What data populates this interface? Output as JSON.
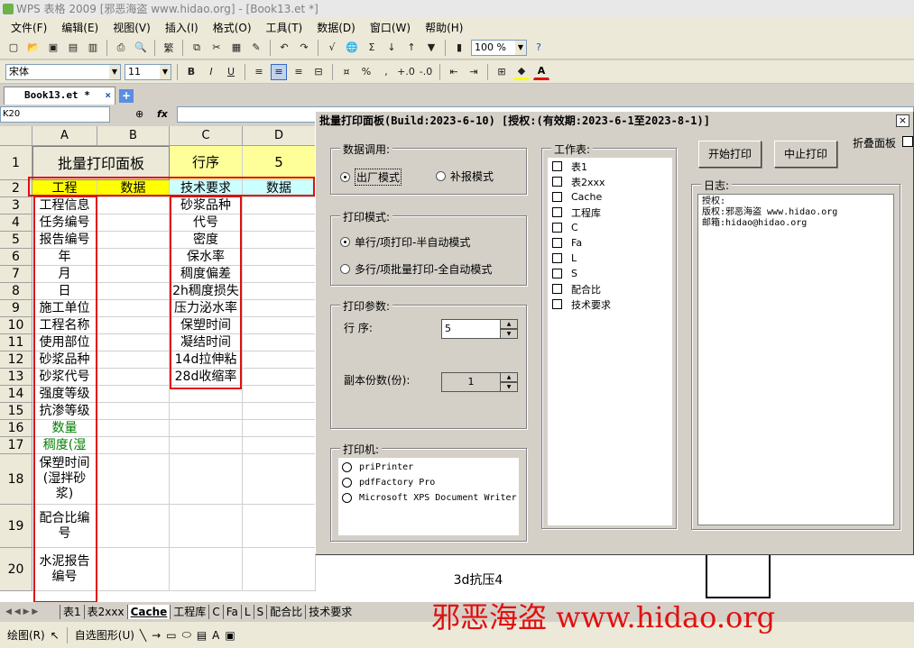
{
  "window": {
    "title": "WPS 表格 2009 [邪恶海盗 www.hidao.org] - [Book13.et *]"
  },
  "menu": [
    "文件(F)",
    "编辑(E)",
    "视图(V)",
    "插入(I)",
    "格式(O)",
    "工具(T)",
    "数据(D)",
    "窗口(W)",
    "帮助(H)"
  ],
  "toolbar": {
    "zoom": "100 %",
    "font": "宋体",
    "size": "11",
    "bold": "B",
    "italic": "I",
    "underline": "U",
    "percent": "%",
    "sigma": "Σ"
  },
  "doc_tab": {
    "name": "Book13.et *",
    "close": "×",
    "add": "+"
  },
  "formula": {
    "namebox": "K20",
    "fx": "fx"
  },
  "sheet": {
    "columns": [
      "A",
      "B",
      "C",
      "D"
    ],
    "rows": [
      {
        "n": "1",
        "a": "批量打印面板",
        "b": "",
        "c": "行序",
        "d": "5"
      },
      {
        "n": "2",
        "a": "工程",
        "b": "数据",
        "c": "技术要求",
        "d": "数据"
      },
      {
        "n": "3",
        "a": "工程信息",
        "c": "砂浆品种"
      },
      {
        "n": "4",
        "a": "任务编号",
        "c": "代号"
      },
      {
        "n": "5",
        "a": "报告编号",
        "c": "密度"
      },
      {
        "n": "6",
        "a": "年",
        "c": "保水率"
      },
      {
        "n": "7",
        "a": "月",
        "c": "稠度偏差"
      },
      {
        "n": "8",
        "a": "日",
        "c": "2h稠度损失"
      },
      {
        "n": "9",
        "a": "施工单位",
        "c": "压力泌水率"
      },
      {
        "n": "10",
        "a": "工程名称",
        "c": "保塑时间"
      },
      {
        "n": "11",
        "a": "使用部位",
        "c": "凝结时间"
      },
      {
        "n": "12",
        "a": "砂浆品种",
        "c": "14d拉伸粘"
      },
      {
        "n": "13",
        "a": "砂浆代号",
        "c": "28d收缩率"
      },
      {
        "n": "14",
        "a": "强度等级",
        "c": ""
      },
      {
        "n": "15",
        "a": "抗渗等级",
        "c": ""
      },
      {
        "n": "16",
        "a": "数量",
        "c": ""
      },
      {
        "n": "17",
        "a": "稠度(湿",
        "c": ""
      },
      {
        "n": "18",
        "a": "保塑时间\n(湿拌砂\n浆)",
        "c": ""
      },
      {
        "n": "19",
        "a": "配合比编\n号",
        "c": ""
      },
      {
        "n": "20",
        "a": "水泥报告\n编号",
        "c": ""
      }
    ],
    "extra_cell": "3d抗压4"
  },
  "sheet_tabs": [
    "表1",
    "表2xxx",
    "Cache",
    "工程库",
    "C",
    "Fa",
    "L",
    "S",
    "配合比",
    "技术要求"
  ],
  "drawbar": {
    "draw": "绘图(R)",
    "autoshape": "自选图形(U)"
  },
  "watermark": "邪恶海盗 www.hidao.org",
  "dialog": {
    "title": "批量打印面板(Build:2023-6-10) [授权:(有效期:2023-6-1至2023-8-1)]",
    "close": "×",
    "data_source": {
      "legend": "数据调用:",
      "opt1": "出厂模式",
      "opt2": "补报模式"
    },
    "print_mode": {
      "legend": "打印模式:",
      "opt1": "单行/项打印-半自动模式",
      "opt2": "多行/项批量打印-全自动模式"
    },
    "params": {
      "legend": "打印参数:",
      "row_label": "行 序:",
      "row_value": "5",
      "copies_label": "副本份数(份):",
      "copies_value": "1"
    },
    "printer": {
      "legend": "打印机:",
      "items": [
        "priPrinter",
        "pdfFactory Pro",
        "Microsoft XPS Document Writer"
      ]
    },
    "worksheets": {
      "legend": "工作表:",
      "items": [
        "表1",
        "表2xxx",
        "Cache",
        "工程库",
        "C",
        "Fa",
        "L",
        "S",
        "配合比",
        "技术要求"
      ]
    },
    "buttons": {
      "start": "开始打印",
      "stop": "中止打印"
    },
    "fold": "折叠面板",
    "log": {
      "legend": "日志:",
      "lines": [
        "授权:",
        "版权:邪恶海盗 www.hidao.org",
        "邮箱:hidao@hidao.org"
      ]
    }
  }
}
